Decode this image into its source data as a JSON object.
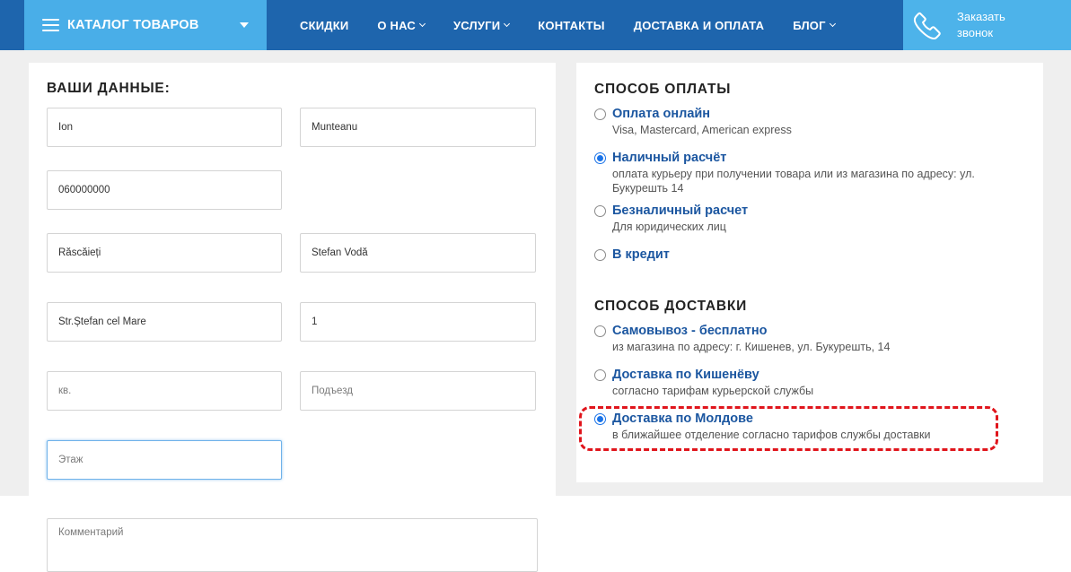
{
  "header": {
    "catalog_label": "КАТАЛОГ ТОВАРОВ",
    "nav": [
      {
        "label": "СКИДКИ",
        "dropdown": false
      },
      {
        "label": "О НАС",
        "dropdown": true
      },
      {
        "label": "УСЛУГИ",
        "dropdown": true
      },
      {
        "label": "КОНТАКТЫ",
        "dropdown": false
      },
      {
        "label": "ДОСТАВКА И ОПЛАТА",
        "dropdown": false
      },
      {
        "label": "БЛОГ",
        "dropdown": true
      }
    ],
    "callback_label": "Заказать звонок"
  },
  "form": {
    "title": "ВАШИ ДАННЫЕ:",
    "first_name": {
      "value": "Ion",
      "placeholder": ""
    },
    "last_name": {
      "value": "Munteanu",
      "placeholder": ""
    },
    "phone": {
      "value": "060000000",
      "placeholder": ""
    },
    "district": {
      "value": "Răscăieți",
      "placeholder": ""
    },
    "city": {
      "value": "Stefan Vodă",
      "placeholder": ""
    },
    "street": {
      "value": "Str.Ștefan cel Mare",
      "placeholder": ""
    },
    "house": {
      "value": "1",
      "placeholder": ""
    },
    "apartment": {
      "value": "",
      "placeholder": "кв."
    },
    "entrance": {
      "value": "",
      "placeholder": "Подъезд"
    },
    "floor": {
      "value": "",
      "placeholder": "Этаж"
    },
    "comment": {
      "value": "",
      "placeholder": "Комментарий"
    }
  },
  "payment": {
    "title": "СПОСОБ ОПЛАТЫ",
    "options": [
      {
        "title": "Оплата онлайн",
        "subtitle": "Visa, Mastercard, American express",
        "selected": false
      },
      {
        "title": "Наличный расчёт",
        "subtitle": "оплата курьеру при получении товара или из магазина по адресу: ул. Букурешть 14",
        "selected": true
      },
      {
        "title": "Безналичный расчет",
        "subtitle": "Для юридических лиц",
        "selected": false
      },
      {
        "title": "В кредит",
        "subtitle": "",
        "selected": false
      }
    ]
  },
  "delivery": {
    "title": "СПОСОБ ДОСТАВКИ",
    "options": [
      {
        "title": "Самовывоз - бесплатно",
        "subtitle": "из магазина по адресу: г. Кишенев, ул. Букурешть, 14",
        "selected": false
      },
      {
        "title": "Доставка по Кишенёву",
        "subtitle": "согласно тарифам курьерской службы",
        "selected": false
      },
      {
        "title": "Доставка по Молдове",
        "subtitle": "в ближайшее отделение согласно тарифов службы доставки",
        "selected": true
      }
    ]
  },
  "colors": {
    "nav_bg": "#1e65ad",
    "catalog_bg": "#49aee8",
    "callback_bg": "#4db3ea",
    "link_blue": "#1b56a0",
    "highlight_red": "#e0151c"
  },
  "icons": {
    "menu": "hamburger-icon",
    "caret": "caret-down-icon",
    "phone": "phone-icon"
  }
}
